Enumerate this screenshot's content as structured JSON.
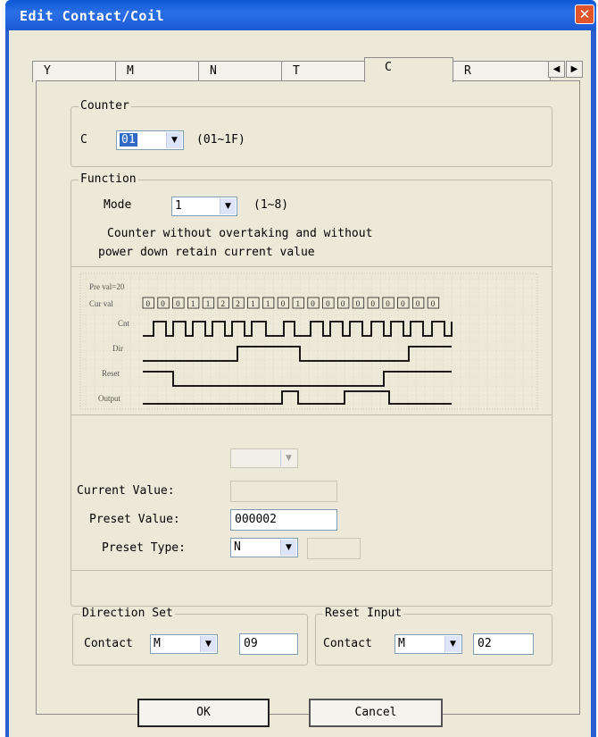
{
  "window": {
    "title": "Edit Contact/Coil"
  },
  "tabs": [
    {
      "label": "Y"
    },
    {
      "label": "M"
    },
    {
      "label": "N"
    },
    {
      "label": "T"
    },
    {
      "label": "C",
      "active": true
    },
    {
      "label": "R"
    }
  ],
  "counter": {
    "legend": "Counter",
    "prefix": "C",
    "selected": "01",
    "range": "(01~1F)"
  },
  "function": {
    "legend": "Function",
    "mode_label": "Mode",
    "mode_value": "1",
    "mode_range": "(1~8)",
    "description_line1": "Counter without overtaking and without",
    "description_line2": "power down retain current value"
  },
  "timing": {
    "preset_label": "Pre val=20",
    "cur_label": "Cur val",
    "cur_values": [
      "0",
      "0",
      "0",
      "1",
      "1",
      "2",
      "2",
      "1",
      "1",
      "0",
      "1",
      "0",
      "0",
      "0",
      "0",
      "0",
      "0",
      "0",
      "0",
      "0"
    ],
    "signals": [
      "Cnt",
      "Dir",
      "Reset",
      "Output"
    ]
  },
  "fields": {
    "current_value_label": "Current Value:",
    "current_value": "",
    "preset_value_label": "Preset Value:",
    "preset_value": "000002",
    "preset_type_label": "Preset Type:",
    "preset_type": "N",
    "preset_type_extra": ""
  },
  "direction_set": {
    "legend": "Direction Set",
    "contact_label": "Contact",
    "type": "M",
    "number": "09"
  },
  "reset_input": {
    "legend": "Reset Input",
    "contact_label": "Contact",
    "type": "M",
    "number": "02"
  },
  "buttons": {
    "ok": "OK",
    "cancel": "Cancel"
  },
  "colors": {
    "titlebar": "#0a58d6",
    "close": "#e0552b",
    "dialog_bg": "#ece9d8",
    "selection": "#316ac5"
  }
}
